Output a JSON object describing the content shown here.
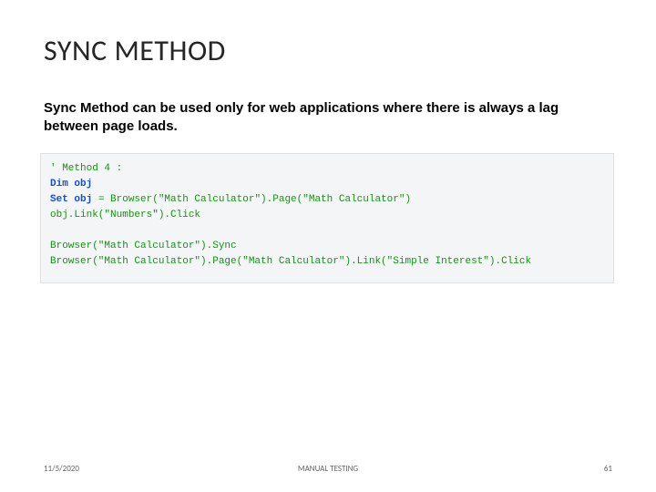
{
  "title": "SYNC METHOD",
  "description": "Sync Method can be used only for web applications where there is always a lag between page loads.",
  "code": {
    "l1": "' Method 4 :",
    "l2": "Dim obj",
    "l3_a": "Set obj",
    "l3_b": " = Browser(\"Math Calculator\").Page(\"Math Calculator\")",
    "l4": "obj.Link(\"Numbers\").Click",
    "l5": "",
    "l6": "Browser(\"Math Calculator\").Sync",
    "l7": "Browser(\"Math Calculator\").Page(\"Math Calculator\").Link(\"Simple Interest\").Click"
  },
  "footer": {
    "date": "11/5/2020",
    "label": "MANUAL TESTING",
    "page": "61"
  }
}
